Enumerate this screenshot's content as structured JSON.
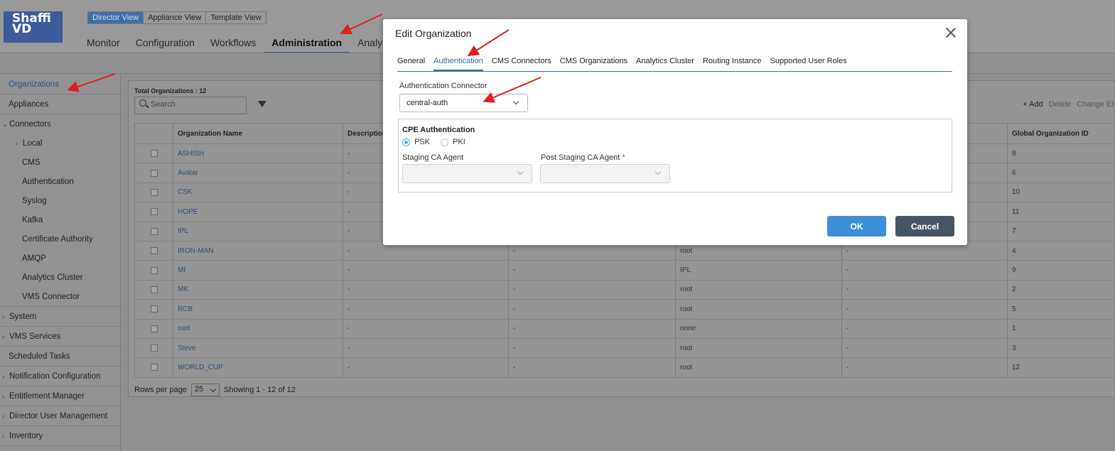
{
  "app": {
    "logo_line1": "Shaffi",
    "logo_line2": "VD",
    "views": [
      "Director View",
      "Appliance View",
      "Template View"
    ],
    "nav": [
      "Monitor",
      "Configuration",
      "Workflows",
      "Administration",
      "Analyt"
    ]
  },
  "sidebar": {
    "items": [
      "Organizations",
      "Appliances",
      "Connectors",
      "Local",
      "CMS",
      "Authentication",
      "Syslog",
      "Kafka",
      "Certificate Authority",
      "AMQP",
      "Analytics Cluster",
      "VMS Connector",
      "System",
      "VMS Services",
      "Scheduled Tasks",
      "Notification Configuration",
      "Entitlement Manager",
      "Director User Management",
      "Inventory"
    ]
  },
  "orgs": {
    "total_label": "Total Organizations : 12",
    "search_placeholder": "Search",
    "actions": {
      "add": "+ Add",
      "delete": "Delete",
      "change": "Change Er"
    },
    "columns": [
      "Organization Name",
      "Description",
      "",
      "",
      "",
      "Global Organization ID"
    ],
    "rows": [
      {
        "name": "ASHISH",
        "desc": "-",
        "c3": "",
        "parent": "",
        "c5": "",
        "gid": "8"
      },
      {
        "name": "Avatar",
        "desc": "-",
        "c3": "",
        "parent": "",
        "c5": "",
        "gid": "6"
      },
      {
        "name": "CSK",
        "desc": "-",
        "c3": "",
        "parent": "",
        "c5": "",
        "gid": "10"
      },
      {
        "name": "HOPE",
        "desc": "-",
        "c3": "",
        "parent": "",
        "c5": "",
        "gid": "11"
      },
      {
        "name": "IPL",
        "desc": "-",
        "c3": "",
        "parent": "",
        "c5": "",
        "gid": "7"
      },
      {
        "name": "IRON-MAN",
        "desc": "-",
        "c3": "-",
        "parent": "root",
        "c5": "-",
        "gid": "4"
      },
      {
        "name": "MI",
        "desc": "-",
        "c3": "-",
        "parent": "IPL",
        "c5": "-",
        "gid": "9"
      },
      {
        "name": "MK",
        "desc": "-",
        "c3": "-",
        "parent": "root",
        "c5": "-",
        "gid": "2"
      },
      {
        "name": "RCB",
        "desc": "-",
        "c3": "-",
        "parent": "root",
        "c5": "-",
        "gid": "5"
      },
      {
        "name": "root",
        "desc": "-",
        "c3": "-",
        "parent": "none",
        "c5": "-",
        "gid": "1"
      },
      {
        "name": "Steve",
        "desc": "-",
        "c3": "-",
        "parent": "root",
        "c5": "-",
        "gid": "3"
      },
      {
        "name": "WORLD_CUP",
        "desc": "-",
        "c3": "-",
        "parent": "root",
        "c5": "-",
        "gid": "12"
      }
    ],
    "footer": {
      "rows_per_page_label": "Rows per page",
      "rows_per_page": "25",
      "showing": "Showing  1  -  12  of  12"
    }
  },
  "modal": {
    "title": "Edit Organization",
    "tabs": [
      "General",
      "Authentication",
      "CMS Connectors",
      "CMS Organizations",
      "Analytics Cluster",
      "Routing Instance",
      "Supported User Roles"
    ],
    "auth_connector_label": "Authentication Connector",
    "auth_connector_value": "central-auth",
    "cpe_title": "CPE Authentication",
    "radio_psk": "PSK",
    "radio_pki": "PKI",
    "staging_label": "Staging CA Agent",
    "post_staging_label": "Post Staging CA Agent",
    "required_mark": "*",
    "ok_label": "OK",
    "cancel_label": "Cancel"
  },
  "colors": {
    "accent": "#3d8fd6",
    "arrow": "#e02020"
  }
}
